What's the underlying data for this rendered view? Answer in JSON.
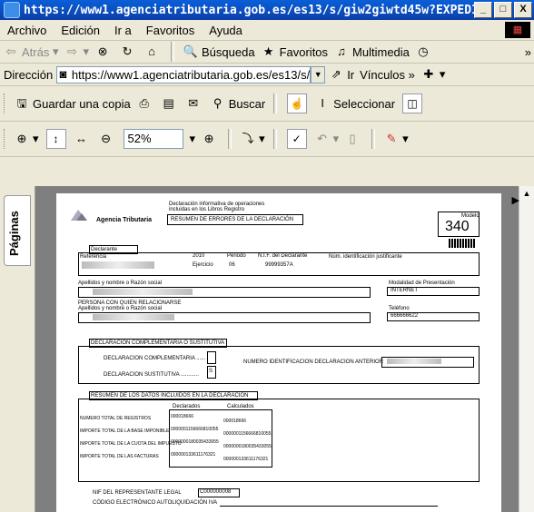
{
  "window": {
    "title": "https://www1.agenciatributaria.gob.es/es13/s/giw2giwtd45w?EXPEDIE...",
    "minimize": "_",
    "maximize": "□",
    "close": "X"
  },
  "menu": [
    "Archivo",
    "Edición",
    "Ir a",
    "Favoritos",
    "Ayuda"
  ],
  "nav": {
    "back": "Atrás",
    "search": "Búsqueda",
    "favorites": "Favoritos",
    "media": "Multimedia",
    "more": "»"
  },
  "address": {
    "label": "Dirección",
    "url": "https://www1.agenciatributaria.gob.es/es13/s/",
    "go": "Ir",
    "links": "Vínculos"
  },
  "pdf_toolbar": {
    "save_copy": "Guardar una copia",
    "search": "Buscar",
    "select": "Seleccionar",
    "zoom": "52%"
  },
  "side": {
    "pages_tab": "Páginas"
  },
  "form": {
    "agency": "Agencia Tributaria",
    "decl_title_1": "Declaración informativa de operaciones",
    "decl_title_2": "incluidas en los Libros Registro",
    "summary_errors": "RESUMEN DE ERRORES DE LA DECLARACIÓN",
    "modelo_label": "Modelo",
    "modelo": "340",
    "declarante": "Declarante",
    "referencia": "Referencia",
    "ejercicio_label": "Ejercicio",
    "ejercicio": "2010",
    "periodo_label": "Periodo",
    "periodo": "06",
    "nif_label": "N.I.F. del Declarante",
    "nif": "99999357A",
    "num_ident": "Núm. identificación justificante",
    "apellidos": "Apellidos y nombre o Razón social",
    "modalidad": "Modalidad de Presentación",
    "modalidad_val": "INTERNET",
    "persona": "PERSONA CON QUIEN RELACIONARSE",
    "apellidos2": "Apellidos y nombre o Razón social",
    "telefono": "Teléfono",
    "telefono_val": "666666622",
    "comp_section": "DECLARACION COMPLEMENTARIA O SUSTITUTIVA",
    "comp": "DECLARACION COMPLEMENTARIA ......",
    "sust": "DECLARACION SUSTITUTIVA ............",
    "sust_val": "S",
    "num_anterior": "NUMERO IDENTIFICACION DECLARACION ANTERIOR",
    "resumen": "RESUMEN DE LOS DATOS INCLUIDOS EN LA DECLARACIÓN",
    "declarados": "Declarados",
    "calculados": "Calculados",
    "rows": [
      {
        "label": "NUMERO TOTAL DE REGISTROS",
        "decl": "000018666",
        "calc": "000018666"
      },
      {
        "label": "IMPORTE TOTAL DE LA BASE IMPONIBLE",
        "decl": "0000001156666810055",
        "calc": "0000001156666810055"
      },
      {
        "label": "IMPORTE TOTAL DE LA CUOTA DEL IMPUESTO",
        "decl": "0000000180035433055",
        "calc": "0000000180035433055"
      },
      {
        "label": "IMPORTE TOTAL DE LAS FACTURAS",
        "decl": "000000133611176321",
        "calc": "000000133611176321"
      }
    ],
    "nif_rep": "NIF DEL REPRESENTANTE LEGAL",
    "nif_rep_val": "C000000008",
    "codigo": "CÓDIGO ELECTRÓNICO AUTOLIQUIDACIÓN IVA"
  }
}
